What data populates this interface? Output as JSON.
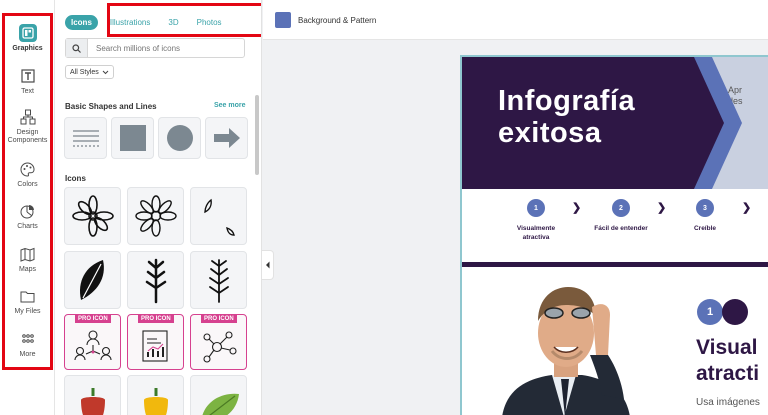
{
  "rail": {
    "items": [
      {
        "label": "Graphics",
        "icon": "graphics-icon",
        "active": true
      },
      {
        "label": "Text",
        "icon": "text-icon"
      },
      {
        "label": "Design Components",
        "icon": "design-components-icon"
      },
      {
        "label": "Colors",
        "icon": "palette-icon"
      },
      {
        "label": "Charts",
        "icon": "pie-chart-icon"
      },
      {
        "label": "Maps",
        "icon": "map-icon"
      },
      {
        "label": "My Files",
        "icon": "folder-icon"
      },
      {
        "label": "More",
        "icon": "grid-dots-icon"
      }
    ]
  },
  "panel": {
    "tabs": [
      "Icons",
      "Illustrations",
      "3D",
      "Photos"
    ],
    "active_tab": "Icons",
    "search_placeholder": "Search millions of icons",
    "styles_filter": "All Styles",
    "basic_shapes_title": "Basic Shapes and Lines",
    "see_more": "See more",
    "icons_title": "Icons",
    "pro_badge": "PRO ICON"
  },
  "topbar": {
    "background_label": "Background & Pattern",
    "swatch_color": "#5b72b7"
  },
  "canvas": {
    "hero_title_line1": "Infografía",
    "hero_title_line2": "exitosa",
    "hero_side_line1": "Apr",
    "hero_side_line2": "des",
    "steps": [
      {
        "num": "1",
        "label_line1": "Visualmente",
        "label_line2": "atractiva"
      },
      {
        "num": "2",
        "label_line1": "Fácil de entender",
        "label_line2": ""
      },
      {
        "num": "3",
        "label_line1": "Creíble",
        "label_line2": ""
      }
    ],
    "big_num": "1",
    "visual_line1": "Visual",
    "visual_line2": "atracti",
    "usa_text": "Usa imágenes"
  },
  "colors": {
    "accent": "#3aa3a9",
    "dark_purple": "#2e1745",
    "blue": "#5b72b7",
    "pro_pink": "#d6418f",
    "highlight_red": "#e30613"
  }
}
